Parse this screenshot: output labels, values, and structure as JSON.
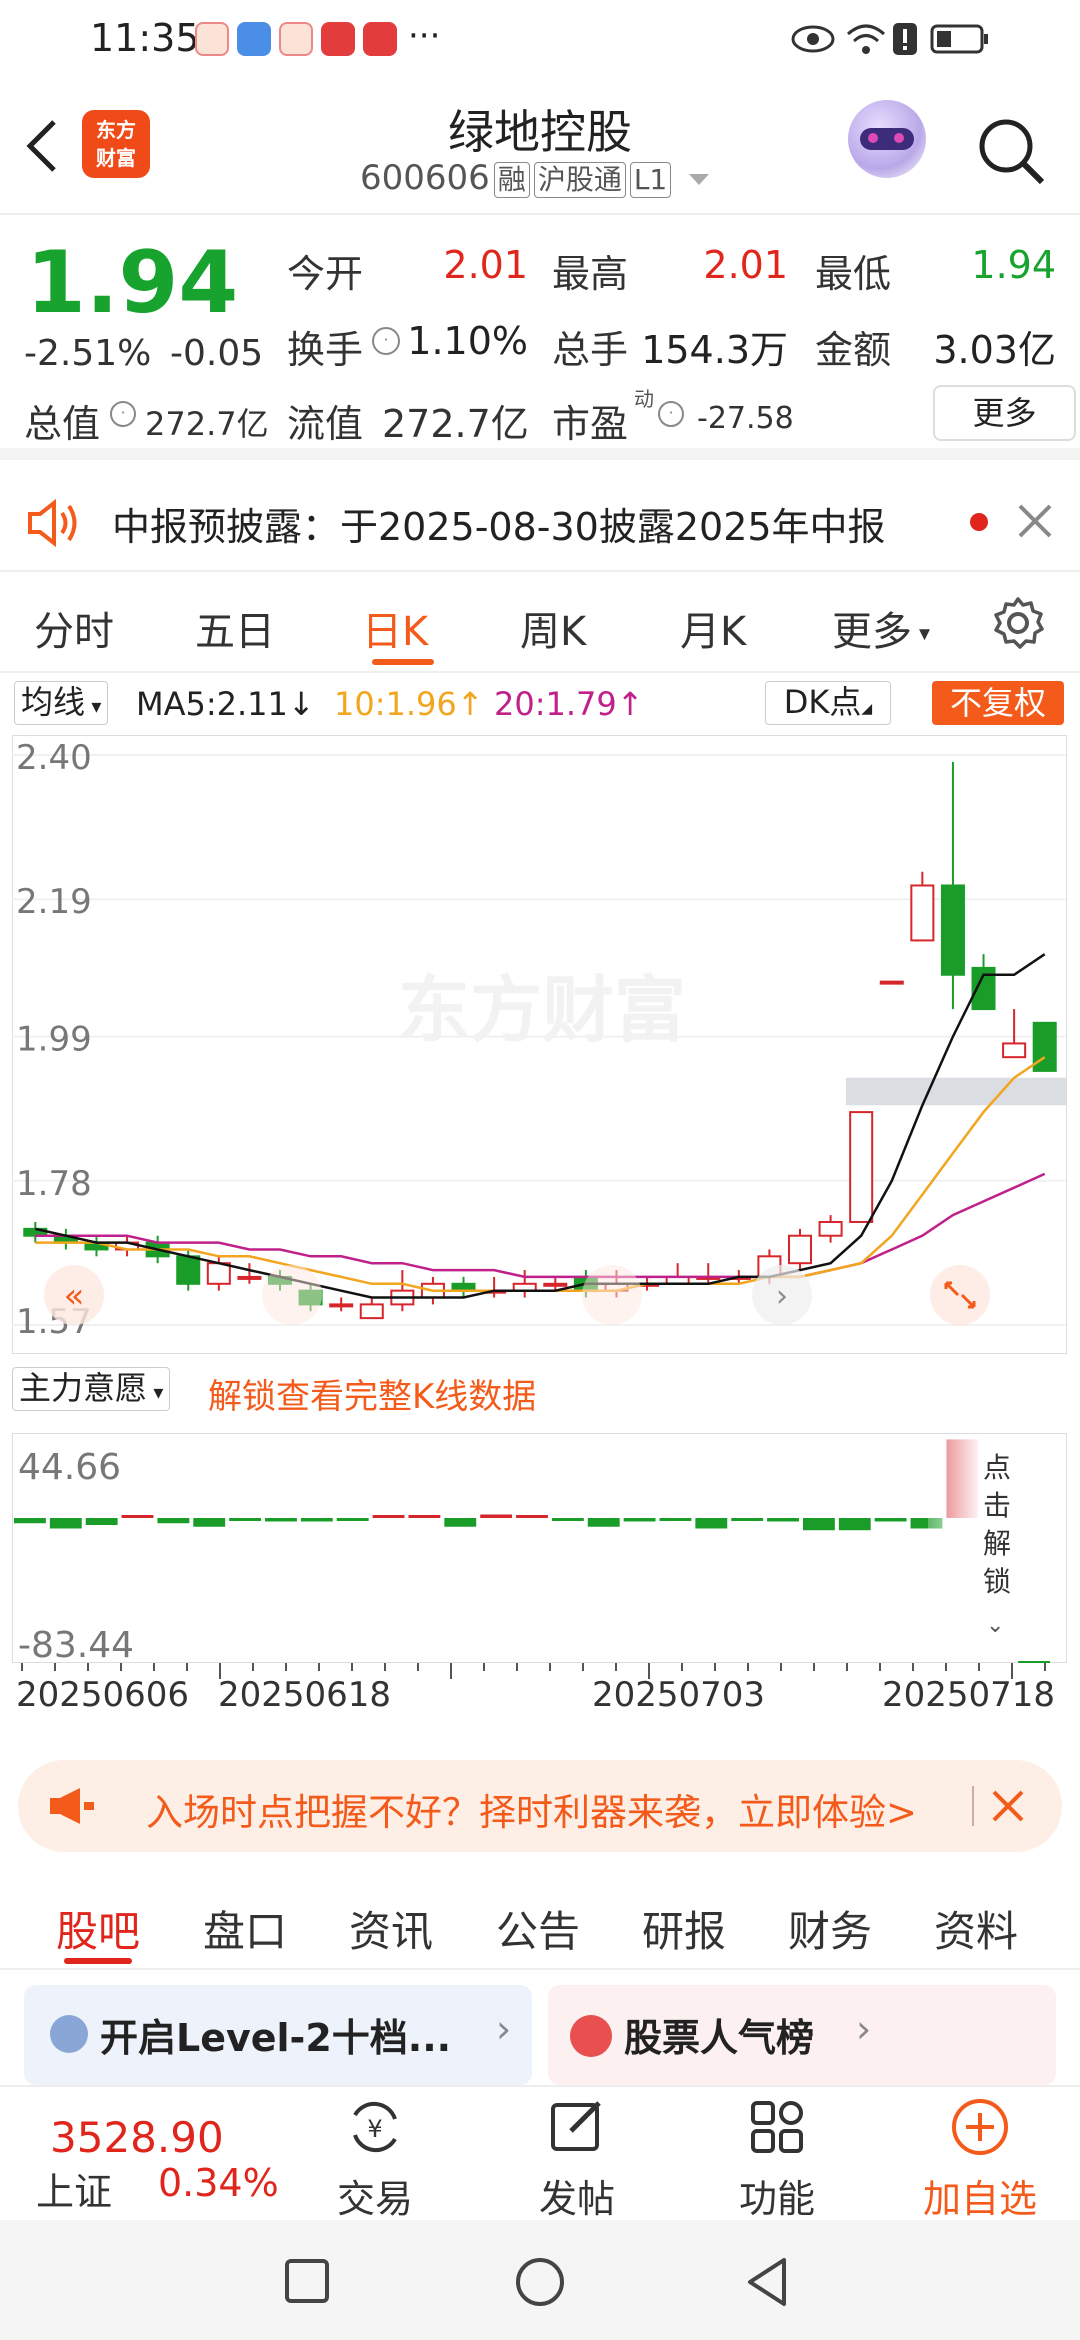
{
  "status": {
    "time": "11:35",
    "dots": "···"
  },
  "header": {
    "title": "绿地控股",
    "code": "600606",
    "tags": [
      "融",
      "沪股通",
      "L1"
    ],
    "logo_lines": [
      "东方",
      "财富"
    ]
  },
  "quote": {
    "price": "1.94",
    "change_pct": "-2.51%",
    "change": "-0.05",
    "open_label": "今开",
    "open": "2.01",
    "high_label": "最高",
    "high": "2.01",
    "low_label": "最低",
    "low": "1.94",
    "turnover_label": "换手",
    "turnover": "1.10%",
    "volume_label": "总手",
    "volume": "154.3万",
    "amount_label": "金额",
    "amount": "3.03亿",
    "mktcap_label": "总值",
    "mktcap": "272.7亿",
    "float_label": "流值",
    "float": "272.7亿",
    "pe_label": "市盈",
    "pe_sup": "动",
    "pe": "-27.58",
    "more": "更多"
  },
  "notice": {
    "text": "中报预披露：于2025-08-30披露2025年中报"
  },
  "ktabs": [
    "分时",
    "五日",
    "日K",
    "周K",
    "月K",
    "更多"
  ],
  "ktab_active": 2,
  "chart": {
    "ma_type": "均线",
    "ma5": "MA5:2.11",
    "ma10": "10:1.96",
    "ma20": "20:1.79",
    "dk": "DK点",
    "adjust": "不复权",
    "watermark": "东方财富",
    "indicator": "主力意愿",
    "unlock_text": "解锁查看完整K线数据",
    "unlock_side": "点击解锁",
    "sub_top": "44.66",
    "sub_bottom": "-83.44",
    "dates": [
      "20250606",
      "20250618",
      "20250703",
      "20250718"
    ]
  },
  "chart_data": {
    "type": "candlestick",
    "y_ticks": [
      2.4,
      2.19,
      1.99,
      1.78,
      1.57
    ],
    "ylim": [
      1.57,
      2.4
    ],
    "candles": [
      {
        "o": 1.71,
        "c": 1.7,
        "h": 1.72,
        "l": 1.69
      },
      {
        "o": 1.7,
        "c": 1.69,
        "h": 1.71,
        "l": 1.68
      },
      {
        "o": 1.69,
        "c": 1.68,
        "h": 1.7,
        "l": 1.67
      },
      {
        "o": 1.68,
        "c": 1.69,
        "h": 1.7,
        "l": 1.67
      },
      {
        "o": 1.69,
        "c": 1.67,
        "h": 1.7,
        "l": 1.66
      },
      {
        "o": 1.67,
        "c": 1.63,
        "h": 1.68,
        "l": 1.62
      },
      {
        "o": 1.63,
        "c": 1.66,
        "h": 1.67,
        "l": 1.62
      },
      {
        "o": 1.64,
        "c": 1.64,
        "h": 1.66,
        "l": 1.63
      },
      {
        "o": 1.64,
        "c": 1.63,
        "h": 1.65,
        "l": 1.62
      },
      {
        "o": 1.62,
        "c": 1.6,
        "h": 1.63,
        "l": 1.59
      },
      {
        "o": 1.6,
        "c": 1.6,
        "h": 1.61,
        "l": 1.59
      },
      {
        "o": 1.58,
        "c": 1.6,
        "h": 1.61,
        "l": 1.58
      },
      {
        "o": 1.6,
        "c": 1.62,
        "h": 1.65,
        "l": 1.59
      },
      {
        "o": 1.61,
        "c": 1.63,
        "h": 1.64,
        "l": 1.6
      },
      {
        "o": 1.63,
        "c": 1.62,
        "h": 1.64,
        "l": 1.61
      },
      {
        "o": 1.62,
        "c": 1.62,
        "h": 1.64,
        "l": 1.61
      },
      {
        "o": 1.62,
        "c": 1.63,
        "h": 1.65,
        "l": 1.61
      },
      {
        "o": 1.63,
        "c": 1.63,
        "h": 1.64,
        "l": 1.62
      },
      {
        "o": 1.64,
        "c": 1.62,
        "h": 1.65,
        "l": 1.61
      },
      {
        "o": 1.62,
        "c": 1.63,
        "h": 1.65,
        "l": 1.61
      },
      {
        "o": 1.63,
        "c": 1.63,
        "h": 1.64,
        "l": 1.62
      },
      {
        "o": 1.63,
        "c": 1.64,
        "h": 1.66,
        "l": 1.63
      },
      {
        "o": 1.64,
        "c": 1.64,
        "h": 1.66,
        "l": 1.63
      },
      {
        "o": 1.64,
        "c": 1.64,
        "h": 1.65,
        "l": 1.63
      },
      {
        "o": 1.64,
        "c": 1.67,
        "h": 1.68,
        "l": 1.63
      },
      {
        "o": 1.66,
        "c": 1.7,
        "h": 1.71,
        "l": 1.65
      },
      {
        "o": 1.7,
        "c": 1.72,
        "h": 1.73,
        "l": 1.69
      },
      {
        "o": 1.72,
        "c": 1.88,
        "h": 1.88,
        "l": 1.72
      },
      {
        "o": 2.07,
        "c": 2.07,
        "h": 2.07,
        "l": 2.07
      },
      {
        "o": 2.13,
        "c": 2.21,
        "h": 2.23,
        "l": 2.13
      },
      {
        "o": 2.21,
        "c": 2.08,
        "h": 2.39,
        "l": 2.03
      },
      {
        "o": 2.09,
        "c": 2.03,
        "h": 2.11,
        "l": 2.03
      },
      {
        "o": 1.96,
        "c": 1.98,
        "h": 2.03,
        "l": 1.96
      },
      {
        "o": 2.01,
        "c": 1.94,
        "h": 2.01,
        "l": 1.94
      }
    ],
    "ma5": [
      1.71,
      1.7,
      1.69,
      1.69,
      1.68,
      1.67,
      1.66,
      1.65,
      1.64,
      1.63,
      1.62,
      1.61,
      1.61,
      1.61,
      1.61,
      1.62,
      1.62,
      1.62,
      1.63,
      1.63,
      1.63,
      1.63,
      1.63,
      1.64,
      1.64,
      1.65,
      1.66,
      1.7,
      1.78,
      1.89,
      1.99,
      2.08,
      2.08,
      2.11
    ],
    "ma10": [
      1.69,
      1.69,
      1.69,
      1.68,
      1.68,
      1.68,
      1.67,
      1.67,
      1.66,
      1.65,
      1.64,
      1.63,
      1.63,
      1.62,
      1.62,
      1.62,
      1.62,
      1.62,
      1.62,
      1.62,
      1.63,
      1.63,
      1.63,
      1.63,
      1.64,
      1.64,
      1.65,
      1.66,
      1.7,
      1.76,
      1.82,
      1.88,
      1.93,
      1.96
    ],
    "ma20": [
      1.7,
      1.7,
      1.7,
      1.7,
      1.69,
      1.69,
      1.69,
      1.68,
      1.68,
      1.67,
      1.67,
      1.66,
      1.66,
      1.65,
      1.65,
      1.65,
      1.64,
      1.64,
      1.64,
      1.64,
      1.64,
      1.64,
      1.64,
      1.64,
      1.64,
      1.64,
      1.65,
      1.66,
      1.68,
      1.7,
      1.73,
      1.75,
      1.77,
      1.79
    ],
    "support_zone": [
      1.89,
      1.93
    ],
    "sub_values": [
      -3,
      -6,
      -4,
      0,
      -3,
      -5,
      -1,
      -2,
      -2,
      -1,
      0,
      0,
      -5,
      2,
      0,
      -1,
      -5,
      -2,
      -1,
      -6,
      -1,
      -2,
      -7,
      -7,
      -2,
      -6,
      45,
      5,
      -83
    ]
  },
  "promo": {
    "text": "入场时点把握不好？择时利器来袭，立即体验>"
  },
  "btabs": [
    "股吧",
    "盘口",
    "资讯",
    "公告",
    "研报",
    "财务",
    "资料"
  ],
  "btab_active": 0,
  "cards": {
    "level2": "开启Level-2十档...",
    "rank": "股票人气榜"
  },
  "tabbar": {
    "index_value": "3528.90",
    "index_name": "上证",
    "index_pct": "0.34%",
    "items": [
      "交易",
      "发帖",
      "功能",
      "加自选"
    ]
  }
}
